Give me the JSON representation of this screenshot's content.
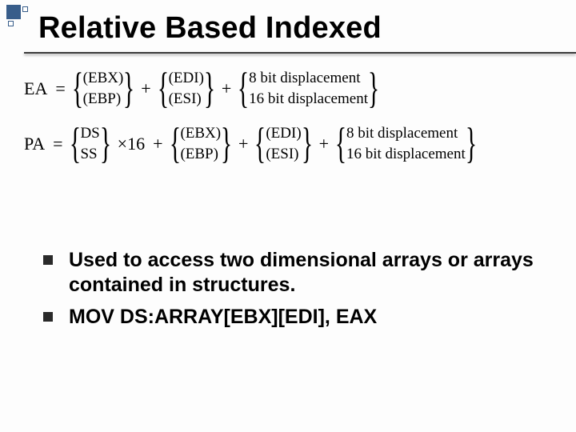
{
  "title": "Relative Based Indexed",
  "eq1": {
    "lhs": "EA",
    "grp1": {
      "r1": "(EBX)",
      "r2": "(EBP)"
    },
    "grp2": {
      "r1": "(EDI)",
      "r2": "(ESI)"
    },
    "grp3": {
      "r1": "8 bit displacement",
      "r2": "16 bit displacement"
    }
  },
  "eq2": {
    "lhs": "PA",
    "grp0": {
      "r1": "DS",
      "r2": "SS"
    },
    "times": "×16",
    "grp1": {
      "r1": "(EBX)",
      "r2": "(EBP)"
    },
    "grp2": {
      "r1": "(EDI)",
      "r2": "(ESI)"
    },
    "grp3": {
      "r1": "8 bit displacement",
      "r2": "16 bit displacement"
    }
  },
  "sym": {
    "eq": "=",
    "plus": "+",
    "lb": "{",
    "rb": "}"
  },
  "bullets": [
    "Used to access two dimensional arrays or arrays contained in structures.",
    "MOV DS:ARRAY[EBX][EDI], EAX"
  ]
}
